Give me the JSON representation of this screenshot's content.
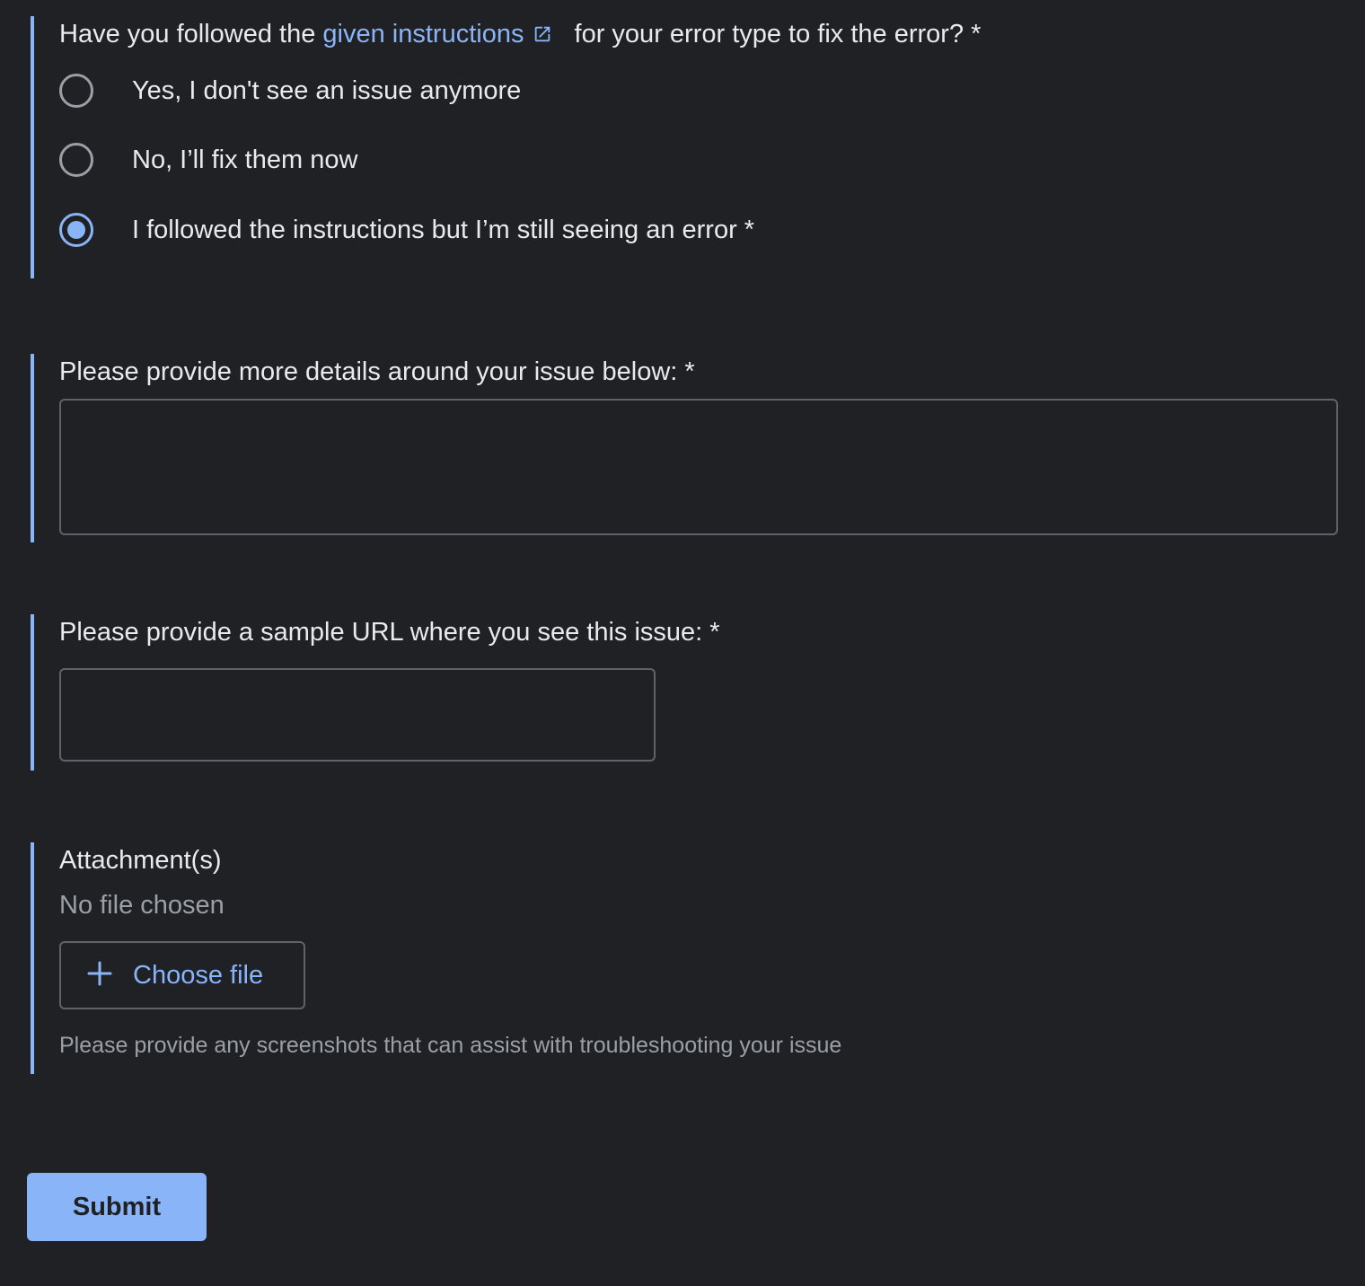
{
  "question1": {
    "prefix": "Have you followed the",
    "link_text": "given instructions",
    "suffix": "for your error type to fix the error? *",
    "options": [
      {
        "label": "Yes, I don't see an issue anymore",
        "checked": false
      },
      {
        "label": "No, I’ll fix them now",
        "checked": false
      },
      {
        "label": "I followed the instructions but I’m still seeing an error *",
        "checked": true
      }
    ]
  },
  "details": {
    "label": "Please provide more details around your issue below: *",
    "value": ""
  },
  "sample_url": {
    "label": "Please provide a sample URL where you see this issue: *",
    "value": ""
  },
  "attachments": {
    "label": "Attachment(s)",
    "status": "No file chosen",
    "button_label": "Choose file",
    "hint": "Please provide any screenshots that can assist with troubleshooting your issue"
  },
  "submit": {
    "label": "Submit"
  },
  "colors": {
    "background": "#202124",
    "accent": "#8ab4f8",
    "text": "#e8eaed",
    "muted": "#9aa0a6",
    "border": "#5f6368"
  },
  "icons": {
    "external_link": "external-link-icon",
    "plus": "plus-icon"
  }
}
